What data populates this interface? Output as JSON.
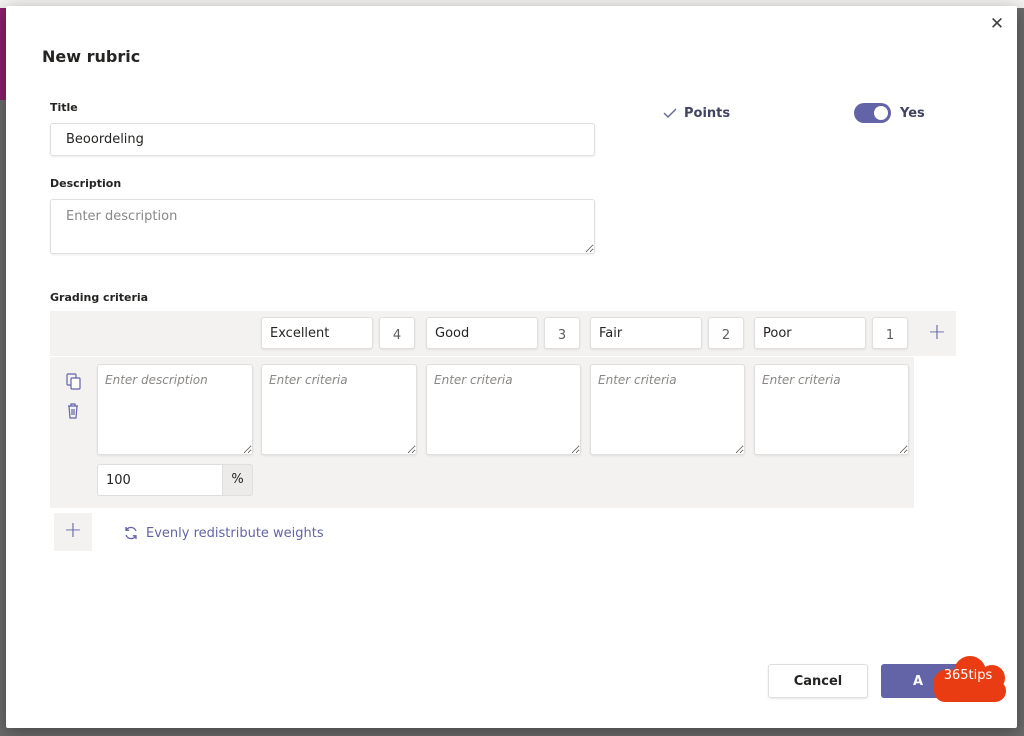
{
  "dialog": {
    "title": "New rubric",
    "close_label": "✕"
  },
  "form": {
    "title_label": "Title",
    "title_value": "Beoordeling",
    "description_label": "Description",
    "description_placeholder": "Enter description"
  },
  "points": {
    "check_icon": "check-icon",
    "label": "Points",
    "toggle_on": true,
    "toggle_label": "Yes"
  },
  "grading": {
    "label": "Grading criteria",
    "levels": [
      {
        "name": "Excellent",
        "points": "4"
      },
      {
        "name": "Good",
        "points": "3"
      },
      {
        "name": "Fair",
        "points": "2"
      },
      {
        "name": "Poor",
        "points": "1"
      }
    ],
    "add_level_icon": "+",
    "row": {
      "description_placeholder": "Enter description",
      "criteria_placeholder": "Enter criteria",
      "weight_value": "100",
      "weight_unit": "%"
    },
    "add_row_icon": "+",
    "redistribute_label": "Evenly redistribute weights"
  },
  "footer": {
    "cancel_label": "Cancel",
    "add_label": "A"
  },
  "watermark": {
    "text": "365tips"
  },
  "colors": {
    "accent": "#6264a7",
    "watermark": "#ea3c12"
  }
}
